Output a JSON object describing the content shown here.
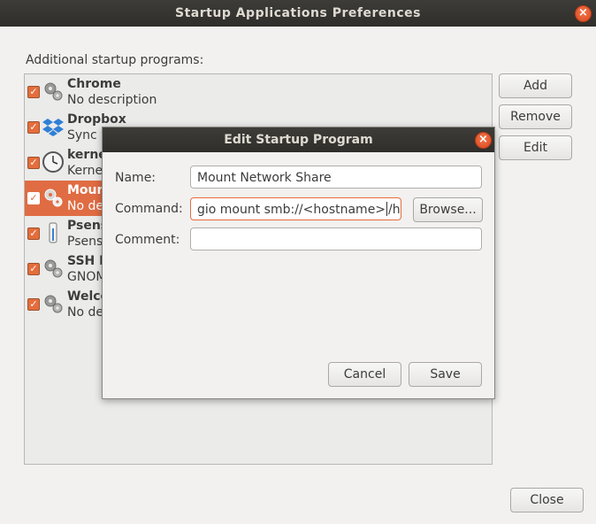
{
  "window": {
    "title": "Startup Applications Preferences",
    "section_label": "Additional startup programs:"
  },
  "programs": [
    {
      "name": "Chrome",
      "desc": "No description",
      "icon": "gears-icon",
      "checked": true
    },
    {
      "name": "Dropbox",
      "desc": "Sync y",
      "icon": "dropbox-icon",
      "checked": true
    },
    {
      "name": "kerne",
      "desc": "Kerne",
      "icon": "clock-icon",
      "checked": true
    },
    {
      "name": "Moun",
      "desc": "No de",
      "icon": "gears-icon",
      "checked": true,
      "selected": true
    },
    {
      "name": "Psens",
      "desc": "Psens",
      "icon": "thermometer-icon",
      "checked": true
    },
    {
      "name": "SSH K",
      "desc": "GNOM",
      "icon": "gears-icon",
      "checked": true
    },
    {
      "name": "Welco",
      "desc": "No de",
      "icon": "gears-icon",
      "checked": true
    }
  ],
  "buttons": {
    "add": "Add",
    "remove": "Remove",
    "edit": "Edit",
    "close": "Close"
  },
  "dialog": {
    "title": "Edit Startup Program",
    "name_label": "Name:",
    "name_value": "Mount Network Share",
    "command_label": "Command:",
    "command_value_before_caret": "gio mount smb://<hostname>",
    "command_value_after_caret": "/hor",
    "browse_label": "Browse...",
    "comment_label": "Comment:",
    "comment_value": "",
    "cancel_label": "Cancel",
    "save_label": "Save"
  },
  "colors": {
    "accent": "#e06c43",
    "titlebar": "#3c3b37"
  }
}
